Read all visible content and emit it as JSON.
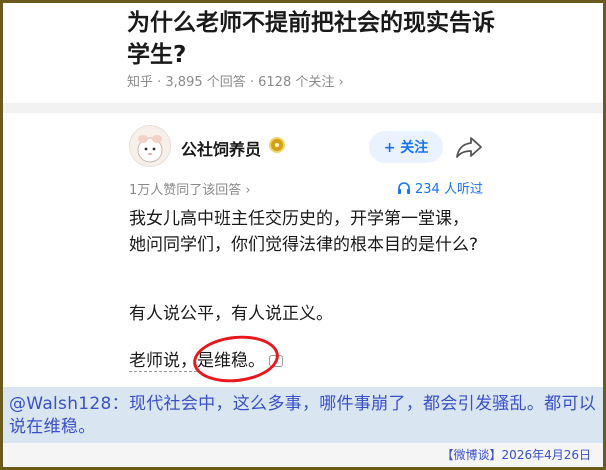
{
  "question": {
    "title": "为什么老师不提前把社会的现实告诉学生?",
    "meta": "知乎 · 3,895 个回答 · 6128 个关注 ›"
  },
  "answer": {
    "author": "公社饲养员",
    "follow_label": "+ 关注",
    "liked": "1万人赞同了该回答 ›",
    "listen": "234 人听过",
    "para1": "我女儿高中班主任交历史的，开学第一堂课，她问同学们，你们觉得法律的根本目的是什么?",
    "para2": "有人说公平，有人说正义。",
    "para3_a": "老师说，",
    "para3_b": "是维稳。"
  },
  "caption": {
    "text": "@Walsh128：现代社会中，这么多事，哪件事崩了，都会引发骚乱。都可以说在维稳。",
    "footer": "【微博谈】2026年4月26日"
  },
  "colors": {
    "accent": "#1772f6",
    "circle": "#e8171b",
    "caption": "#3a50c8"
  }
}
